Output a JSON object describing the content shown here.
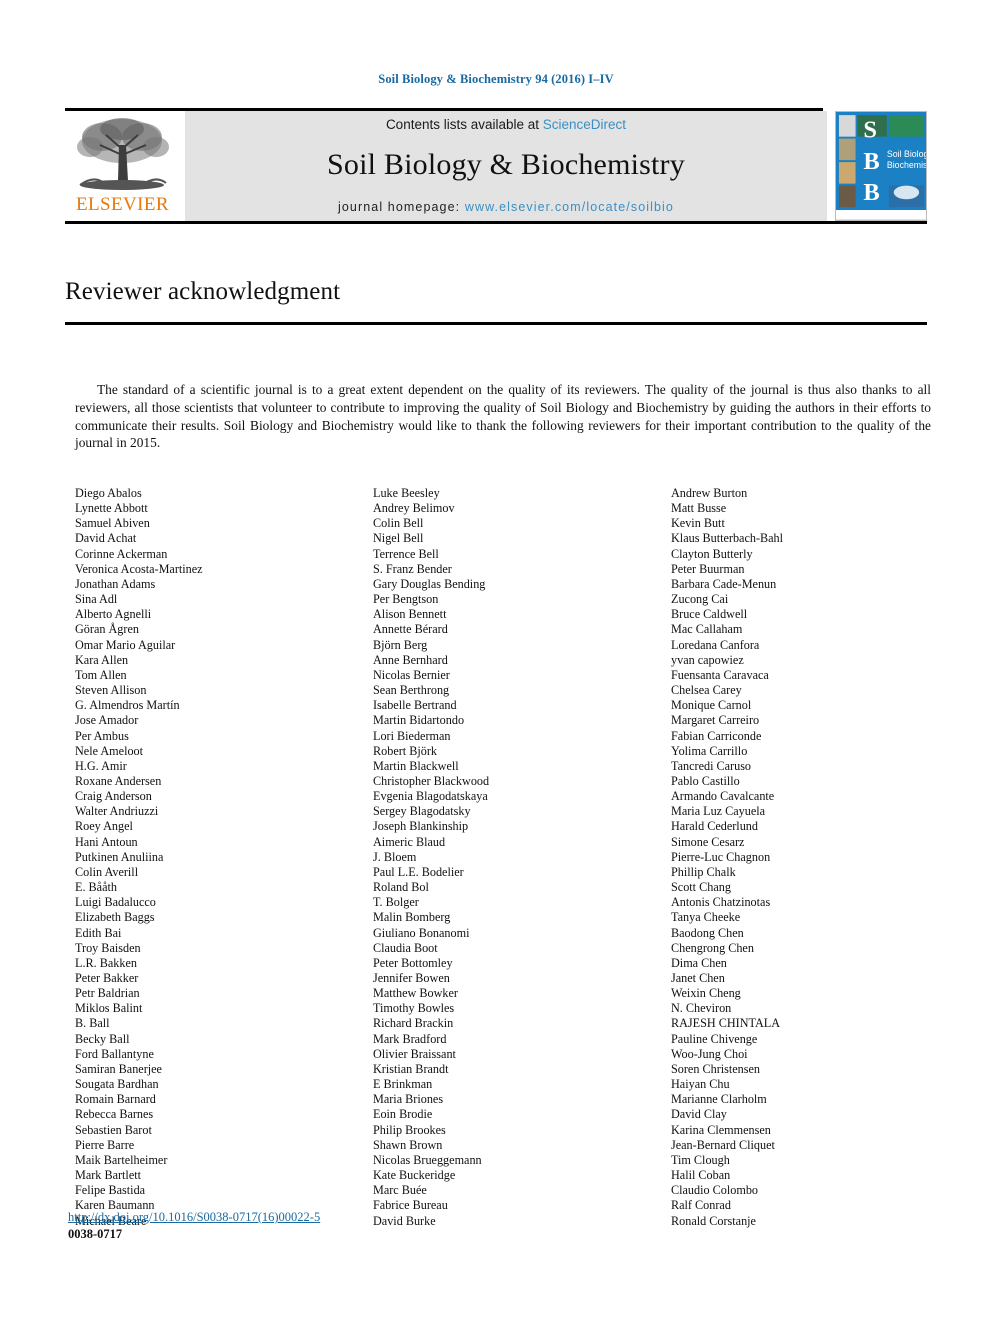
{
  "running_head": "Soil Biology & Biochemistry 94 (2016) I–IV",
  "masthead": {
    "publisher_name": "ELSEVIER",
    "publisher_logo_icon": "elsevier-tree-logo",
    "contents_prefix": "Contents lists available at ",
    "contents_link": "ScienceDirect",
    "journal_title": "Soil Biology & Biochemistry",
    "homepage_prefix": "journal homepage: ",
    "homepage_url": "www.elsevier.com/locate/soilbio",
    "cover": {
      "letters": [
        "S",
        "B",
        "B"
      ],
      "title_line_1": "Soil Biology &",
      "title_line_2": "Biochemistry",
      "background_color": "#1b80c4"
    }
  },
  "article": {
    "title": "Reviewer acknowledgment",
    "intro_paragraph": "The standard of a scientific journal is to a great extent dependent on the quality of its reviewers. The quality of the journal is thus also thanks to all reviewers, all those scientists that volunteer to contribute to improving the quality of Soil Biology and Biochemistry by guiding the authors in their efforts to communicate their results. Soil Biology and Biochemistry would like to thank the following reviewers for their important contribution to the quality of the journal in 2015."
  },
  "reviewer_columns": [
    [
      "Diego Abalos",
      "Lynette Abbott",
      "Samuel Abiven",
      "David Achat",
      "Corinne Ackerman",
      "Veronica Acosta-Martinez",
      "Jonathan Adams",
      "Sina Adl",
      "Alberto Agnelli",
      "Göran Ågren",
      "Omar Mario Aguilar",
      "Kara Allen",
      "Tom Allen",
      "Steven Allison",
      "G. Almendros Martín",
      "Jose Amador",
      "Per Ambus",
      "Nele Ameloot",
      "H.G. Amir",
      "Roxane Andersen",
      "Craig Anderson",
      "Walter Andriuzzi",
      "Roey Angel",
      "Hani Antoun",
      "Putkinen Anuliina",
      "Colin Averill",
      "E. Bååth",
      "Luigi Badalucco",
      "Elizabeth Baggs",
      "Edith Bai",
      "Troy Baisden",
      "L.R. Bakken",
      "Peter Bakker",
      "Petr Baldrian",
      "Miklos Balint",
      "B. Ball",
      "Becky Ball",
      "Ford Ballantyne",
      "Samiran Banerjee",
      "Sougata Bardhan",
      "Romain Barnard",
      "Rebecca Barnes",
      "Sebastien Barot",
      "Pierre Barre",
      "Maik Bartelheimer",
      "Mark Bartlett",
      "Felipe Bastida",
      "Karen Baumann",
      "Michael Beare"
    ],
    [
      "Luke Beesley",
      "Andrey Belimov",
      "Colin Bell",
      "Nigel Bell",
      "Terrence Bell",
      "S. Franz Bender",
      "Gary Douglas Bending",
      "Per Bengtson",
      "Alison Bennett",
      "Annette Bérard",
      "Björn Berg",
      "Anne Bernhard",
      "Nicolas Bernier",
      "Sean Berthrong",
      "Isabelle Bertrand",
      "Martin Bidartondo",
      "Lori Biederman",
      "Robert Björk",
      "Martin Blackwell",
      "Christopher Blackwood",
      "Evgenia Blagodatskaya",
      "Sergey Blagodatsky",
      "Joseph Blankinship",
      "Aimeric Blaud",
      "J. Bloem",
      "Paul L.E. Bodelier",
      "Roland Bol",
      "T. Bolger",
      "Malin Bomberg",
      "Giuliano Bonanomi",
      "Claudia Boot",
      "Peter Bottomley",
      "Jennifer Bowen",
      "Matthew Bowker",
      "Timothy Bowles",
      "Richard Brackin",
      "Mark Bradford",
      "Olivier Braissant",
      "Kristian Brandt",
      "E Brinkman",
      "Maria Briones",
      "Eoin Brodie",
      "Philip Brookes",
      "Shawn Brown",
      "Nicolas Brueggemann",
      "Kate Buckeridge",
      "Marc Buée",
      "Fabrice Bureau",
      "David Burke"
    ],
    [
      "Andrew Burton",
      "Matt Busse",
      "Kevin Butt",
      "Klaus Butterbach-Bahl",
      "Clayton Butterly",
      "Peter Buurman",
      "Barbara Cade-Menun",
      "Zucong Cai",
      "Bruce Caldwell",
      "Mac Callaham",
      "Loredana Canfora",
      "yvan capowiez",
      "Fuensanta Caravaca",
      "Chelsea Carey",
      "Monique Carnol",
      "Margaret Carreiro",
      "Fabian Carriconde",
      "Yolima Carrillo",
      "Tancredi Caruso",
      "Pablo Castillo",
      "Armando Cavalcante",
      "Maria Luz Cayuela",
      "Harald Cederlund",
      "Simone Cesarz",
      "Pierre-Luc Chagnon",
      "Phillip Chalk",
      "Scott Chang",
      "Antonis Chatzinotas",
      "Tanya Cheeke",
      "Baodong Chen",
      "Chengrong Chen",
      "Dima Chen",
      "Janet Chen",
      "Weixin Cheng",
      "N. Cheviron",
      "RAJESH CHINTALA",
      "Pauline Chivenge",
      "Woo-Jung Choi",
      "Soren Christensen",
      "Haiyan Chu",
      "Marianne Clarholm",
      "David Clay",
      "Karina Clemmensen",
      "Jean-Bernard Cliquet",
      "Tim Clough",
      "Halil Coban",
      "Claudio Colombo",
      "Ralf Conrad",
      "Ronald Corstanje"
    ]
  ],
  "footer": {
    "doi_url": "http://dx.doi.org/10.1016/S0038-0717(16)00022-5",
    "issn": "0038-0717"
  }
}
